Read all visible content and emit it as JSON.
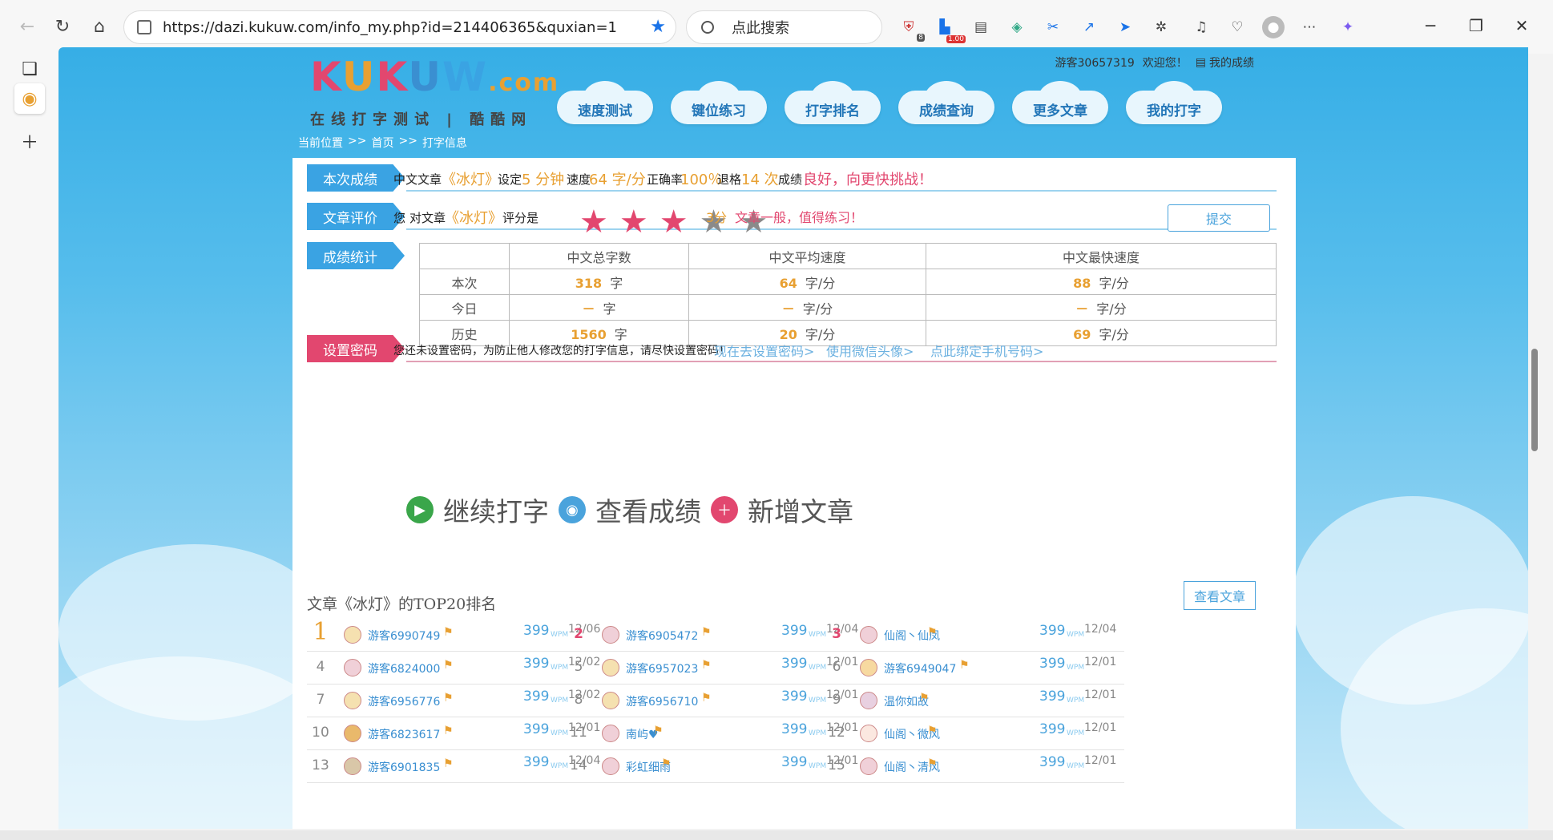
{
  "browser": {
    "url": "https://dazi.kukuw.com/info_my.php?id=214406365&quxian=1",
    "search_placeholder": "点此搜索",
    "ext_badge_1": "8",
    "ext_badge_2": "1.00"
  },
  "site": {
    "logo_main": "KUKUW.com",
    "logo_sub": "在线打字测试 | 酷酷网",
    "welcome_user": "游客30657319",
    "welcome_text": "欢迎您！",
    "my_results": "我的成绩",
    "nav": [
      "速度测试",
      "键位练习",
      "打字排名",
      "成绩查询",
      "更多文章",
      "我的打字"
    ],
    "breadcrumb": [
      "当前位置",
      ">>",
      "首页",
      ">>",
      "打字信息"
    ]
  },
  "result": {
    "tag": "本次成绩",
    "article_label": "中文文章",
    "article_name": "《冰灯》",
    "set_label": "设定",
    "set_value": "5 分钟",
    "speed_label": "速度",
    "speed_value": "64 字/分",
    "accuracy_label": "正确率",
    "accuracy_value": "100％",
    "backspace_label": "退格",
    "backspace_value": "14 次",
    "grade_label": "成绩",
    "grade_value": "良好，向更快挑战！"
  },
  "review": {
    "tag": "文章评价",
    "you": "您",
    "to_article": "对文章",
    "article_name": "《冰灯》",
    "rating_label": "评分是",
    "rating": 3,
    "max_rating": 5,
    "score_text": "3分",
    "comment": "文章一般，值得练习！",
    "submit": "提交"
  },
  "stats": {
    "tag": "成绩统计",
    "headers": [
      "",
      "中文总字数",
      "中文平均速度",
      "中文最快速度"
    ],
    "rows": [
      {
        "label": "本次",
        "total": "318",
        "total_unit": "字",
        "avg": "64",
        "avg_unit": "字/分",
        "max": "88",
        "max_unit": "字/分"
      },
      {
        "label": "今日",
        "total": "－",
        "total_unit": "字",
        "avg": "－",
        "avg_unit": "字/分",
        "max": "－",
        "max_unit": "字/分"
      },
      {
        "label": "历史",
        "total": "1560",
        "total_unit": "字",
        "avg": "20",
        "avg_unit": "字/分",
        "max": "69",
        "max_unit": "字/分"
      }
    ]
  },
  "password": {
    "tag": "设置密码",
    "notice": "您还未设置密码，为防止他人修改您的打字信息，请尽快设置密码！",
    "link_set": "现在去设置密码>",
    "link_wechat": "使用微信头像>",
    "link_phone": "点此绑定手机号码>"
  },
  "actions": {
    "continue": "继续打字",
    "view": "查看成绩",
    "add": "新增文章"
  },
  "ranking": {
    "title": "文章《冰灯》的TOP20排名",
    "view_article": "查看文章",
    "wpm_label": "WPM",
    "items": [
      {
        "rank": "1",
        "name": "游客6990749",
        "score": "399",
        "date": "12/06"
      },
      {
        "rank": "2",
        "name": "游客6905472",
        "score": "399",
        "date": "12/04"
      },
      {
        "rank": "3",
        "name": "仙阁丶仙凤",
        "score": "399",
        "date": "12/04"
      },
      {
        "rank": "4",
        "name": "游客6824000",
        "score": "399",
        "date": "12/02"
      },
      {
        "rank": "5",
        "name": "游客6957023",
        "score": "399",
        "date": "12/01"
      },
      {
        "rank": "6",
        "name": "游客6949047",
        "score": "399",
        "date": "12/01"
      },
      {
        "rank": "7",
        "name": "游客6956776",
        "score": "399",
        "date": "12/02"
      },
      {
        "rank": "8",
        "name": "游客6956710",
        "score": "399",
        "date": "12/01"
      },
      {
        "rank": "9",
        "name": "温你如故",
        "score": "399",
        "date": "12/01"
      },
      {
        "rank": "10",
        "name": "游客6823617",
        "score": "399",
        "date": "12/01"
      },
      {
        "rank": "11",
        "name": "南屿♥",
        "score": "399",
        "date": "12/01"
      },
      {
        "rank": "12",
        "name": "仙阁丶微风",
        "score": "399",
        "date": "12/01"
      },
      {
        "rank": "13",
        "name": "游客6901835",
        "score": "399",
        "date": "12/04"
      },
      {
        "rank": "14",
        "name": "彩虹细雨",
        "score": "399",
        "date": "12/01"
      },
      {
        "rank": "15",
        "name": "仙阁丶清风",
        "score": "399",
        "date": "12/01"
      }
    ]
  },
  "colors": {
    "tag_blue": "#3aa3e3",
    "tag_pink": "#e2476f",
    "orange": "#e8a032",
    "link_blue": "#3a8fd1"
  }
}
